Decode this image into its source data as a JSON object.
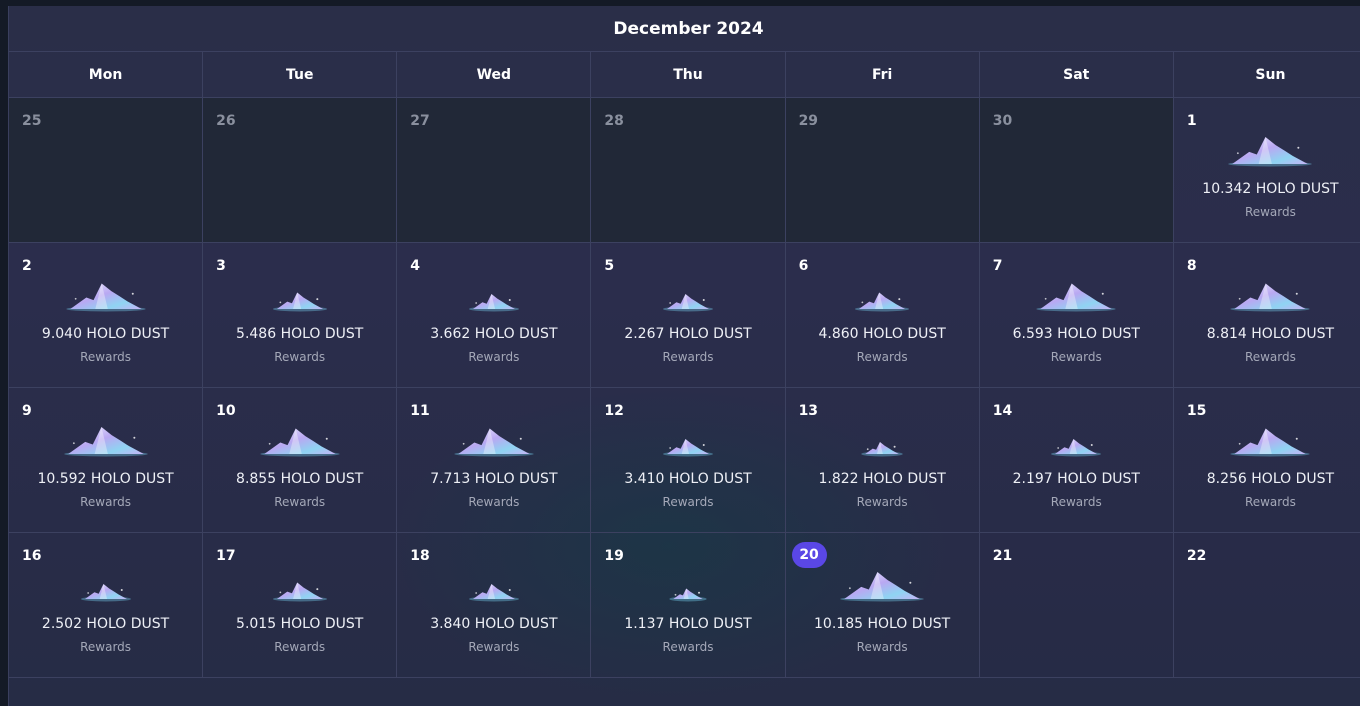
{
  "calendar": {
    "title": "December 2024",
    "weekdays": [
      "Mon",
      "Tue",
      "Wed",
      "Thu",
      "Fri",
      "Sat",
      "Sun"
    ],
    "today": "20",
    "reward_label": "Rewards",
    "unit": "HOLO DUST",
    "weeks": [
      [
        {
          "day": "25",
          "outside": true
        },
        {
          "day": "26",
          "outside": true
        },
        {
          "day": "27",
          "outside": true
        },
        {
          "day": "28",
          "outside": true
        },
        {
          "day": "29",
          "outside": true
        },
        {
          "day": "30",
          "outside": true
        },
        {
          "day": "1",
          "amount": "10.342 HOLO DUST",
          "reward": "Rewards",
          "size": 0.9
        }
      ],
      [
        {
          "day": "2",
          "amount": "9.040 HOLO DUST",
          "reward": "Rewards",
          "size": 0.85
        },
        {
          "day": "3",
          "amount": "5.486 HOLO DUST",
          "reward": "Rewards",
          "size": 0.55
        },
        {
          "day": "4",
          "amount": "3.662 HOLO DUST",
          "reward": "Rewards",
          "size": 0.5
        },
        {
          "day": "5",
          "amount": "2.267 HOLO DUST",
          "reward": "Rewards",
          "size": 0.5
        },
        {
          "day": "6",
          "amount": "4.860 HOLO DUST",
          "reward": "Rewards",
          "size": 0.55
        },
        {
          "day": "7",
          "amount": "6.593 HOLO DUST",
          "reward": "Rewards",
          "size": 0.85
        },
        {
          "day": "8",
          "amount": "8.814 HOLO DUST",
          "reward": "Rewards",
          "size": 0.85
        }
      ],
      [
        {
          "day": "9",
          "amount": "10.592 HOLO DUST",
          "reward": "Rewards",
          "size": 0.9
        },
        {
          "day": "10",
          "amount": "8.855 HOLO DUST",
          "reward": "Rewards",
          "size": 0.85
        },
        {
          "day": "11",
          "amount": "7.713 HOLO DUST",
          "reward": "Rewards",
          "size": 0.85
        },
        {
          "day": "12",
          "amount": "3.410 HOLO DUST",
          "reward": "Rewards",
          "size": 0.5
        },
        {
          "day": "13",
          "amount": "1.822 HOLO DUST",
          "reward": "Rewards",
          "size": 0.4
        },
        {
          "day": "14",
          "amount": "2.197 HOLO DUST",
          "reward": "Rewards",
          "size": 0.5
        },
        {
          "day": "15",
          "amount": "8.256 HOLO DUST",
          "reward": "Rewards",
          "size": 0.85
        }
      ],
      [
        {
          "day": "16",
          "amount": "2.502 HOLO DUST",
          "reward": "Rewards",
          "size": 0.5
        },
        {
          "day": "17",
          "amount": "5.015 HOLO DUST",
          "reward": "Rewards",
          "size": 0.55
        },
        {
          "day": "18",
          "amount": "3.840 HOLO DUST",
          "reward": "Rewards",
          "size": 0.5
        },
        {
          "day": "19",
          "amount": "1.137 HOLO DUST",
          "reward": "Rewards",
          "size": 0.35
        },
        {
          "day": "20",
          "amount": "10.185 HOLO DUST",
          "reward": "Rewards",
          "size": 0.9,
          "today": true
        },
        {
          "day": "21"
        },
        {
          "day": "22"
        }
      ]
    ]
  },
  "icons": {
    "reward": "holo-dust-pile-icon"
  },
  "colors": {
    "accent": "#5a47e6",
    "background": "#2a2e48",
    "outside_day": "#212837"
  }
}
